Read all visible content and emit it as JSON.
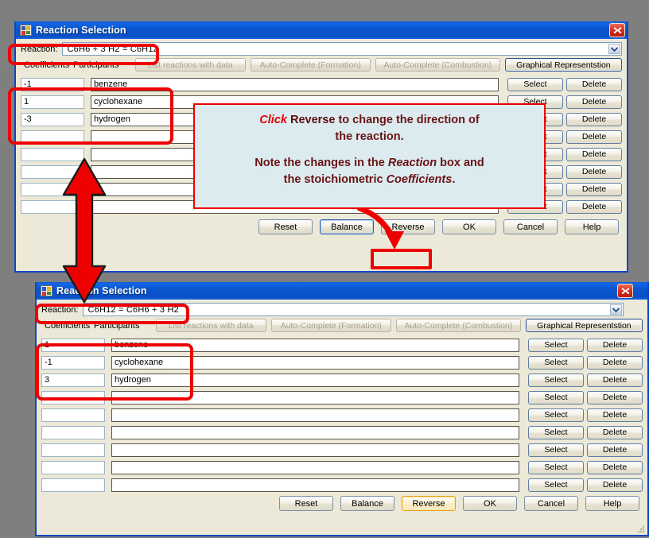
{
  "background_color": "#7f7f7f",
  "accent_blue": "#0a46c8",
  "annotation_red": "#ee0000",
  "window_top": {
    "title": "Reaction Selection",
    "close_icon": "close-icon",
    "reaction": {
      "label": "Reaction:",
      "value": "C6H6 + 3 H2  =  C6H12",
      "dropdown_icon": "chevron-down-icon"
    },
    "columns": {
      "coefficients": "Coefficients",
      "participants": "Participants"
    },
    "toolbar": [
      {
        "label": "List reactions with data",
        "state": "disabled"
      },
      {
        "label": "Auto-Complete (Formation)",
        "state": "disabled"
      },
      {
        "label": "Auto-Complete (Combustion)",
        "state": "disabled"
      },
      {
        "label": "Graphical Representstion",
        "state": "default"
      }
    ],
    "rows": [
      {
        "coefficient": "-1",
        "participant": "benzene",
        "select": "Select",
        "delete": "Delete"
      },
      {
        "coefficient": "1",
        "participant": "cyclohexane",
        "select": "Select",
        "delete": "Delete"
      },
      {
        "coefficient": "-3",
        "participant": "hydrogen",
        "select": "Select",
        "delete": "Delete"
      },
      {
        "coefficient": "",
        "participant": "",
        "select": "Select",
        "delete": "Delete"
      },
      {
        "coefficient": "",
        "participant": "",
        "select": "Select",
        "delete": "Delete"
      },
      {
        "coefficient": "",
        "participant": "",
        "select": "Select",
        "delete": "Delete"
      },
      {
        "coefficient": "",
        "participant": "",
        "select": "Select",
        "delete": "Delete"
      },
      {
        "coefficient": "",
        "participant": "",
        "select": "Select",
        "delete": "Delete"
      }
    ],
    "footer": [
      {
        "label": "Reset",
        "state": "normal"
      },
      {
        "label": "Balance",
        "state": "focus"
      },
      {
        "label": "Reverse",
        "state": "normal"
      },
      {
        "label": "OK",
        "state": "normal"
      },
      {
        "label": "Cancel",
        "state": "normal"
      },
      {
        "label": "Help",
        "state": "normal"
      }
    ]
  },
  "window_bottom": {
    "title": "Reaction Selection",
    "close_icon": "close-icon",
    "reaction": {
      "label": "Reaction:",
      "value": "C6H12  =  C6H6 + 3 H2",
      "dropdown_icon": "chevron-down-icon"
    },
    "columns": {
      "coefficients": "Coefficients",
      "participants": "Participants"
    },
    "toolbar": [
      {
        "label": "List reactions with data",
        "state": "disabled"
      },
      {
        "label": "Auto-Complete (Formation)",
        "state": "disabled"
      },
      {
        "label": "Auto-Complete (Combustion)",
        "state": "disabled"
      },
      {
        "label": "Graphical Representstion",
        "state": "default"
      }
    ],
    "rows": [
      {
        "coefficient": "1",
        "participant": "benzene",
        "select": "Select",
        "delete": "Delete"
      },
      {
        "coefficient": "-1",
        "participant": "cyclohexane",
        "select": "Select",
        "delete": "Delete"
      },
      {
        "coefficient": "3",
        "participant": "hydrogen",
        "select": "Select",
        "delete": "Delete"
      },
      {
        "coefficient": "",
        "participant": "",
        "select": "Select",
        "delete": "Delete"
      },
      {
        "coefficient": "",
        "participant": "",
        "select": "Select",
        "delete": "Delete"
      },
      {
        "coefficient": "",
        "participant": "",
        "select": "Select",
        "delete": "Delete"
      },
      {
        "coefficient": "",
        "participant": "",
        "select": "Select",
        "delete": "Delete"
      },
      {
        "coefficient": "",
        "participant": "",
        "select": "Select",
        "delete": "Delete"
      },
      {
        "coefficient": "",
        "participant": "",
        "select": "Select",
        "delete": "Delete"
      }
    ],
    "footer": [
      {
        "label": "Reset",
        "state": "normal"
      },
      {
        "label": "Balance",
        "state": "normal"
      },
      {
        "label": "Reverse",
        "state": "hover"
      },
      {
        "label": "OK",
        "state": "normal"
      },
      {
        "label": "Cancel",
        "state": "normal"
      },
      {
        "label": "Help",
        "state": "normal"
      }
    ]
  },
  "annotations": {
    "callout": {
      "line1_a": "Click",
      "line1_b": "Reverse",
      "line1_c": "to change the direction of",
      "line2": "the reaction.",
      "line3_a": "Note the changes in the",
      "line3_b": "Reaction",
      "line3_c": "box and",
      "line4_a": "the stoichiometric",
      "line4_b": "Coefficients",
      "line4_c": "."
    },
    "double_arrow_icon": "double-headed-vertical-arrow-icon",
    "curved_arrow_icon": "curved-arrow-icon",
    "highlight_boxes": [
      "reaction-field-highlight-top",
      "coefficients-highlight-top",
      "reverse-button-highlight-top",
      "reaction-field-highlight-bottom",
      "coefficients-highlight-bottom"
    ]
  }
}
